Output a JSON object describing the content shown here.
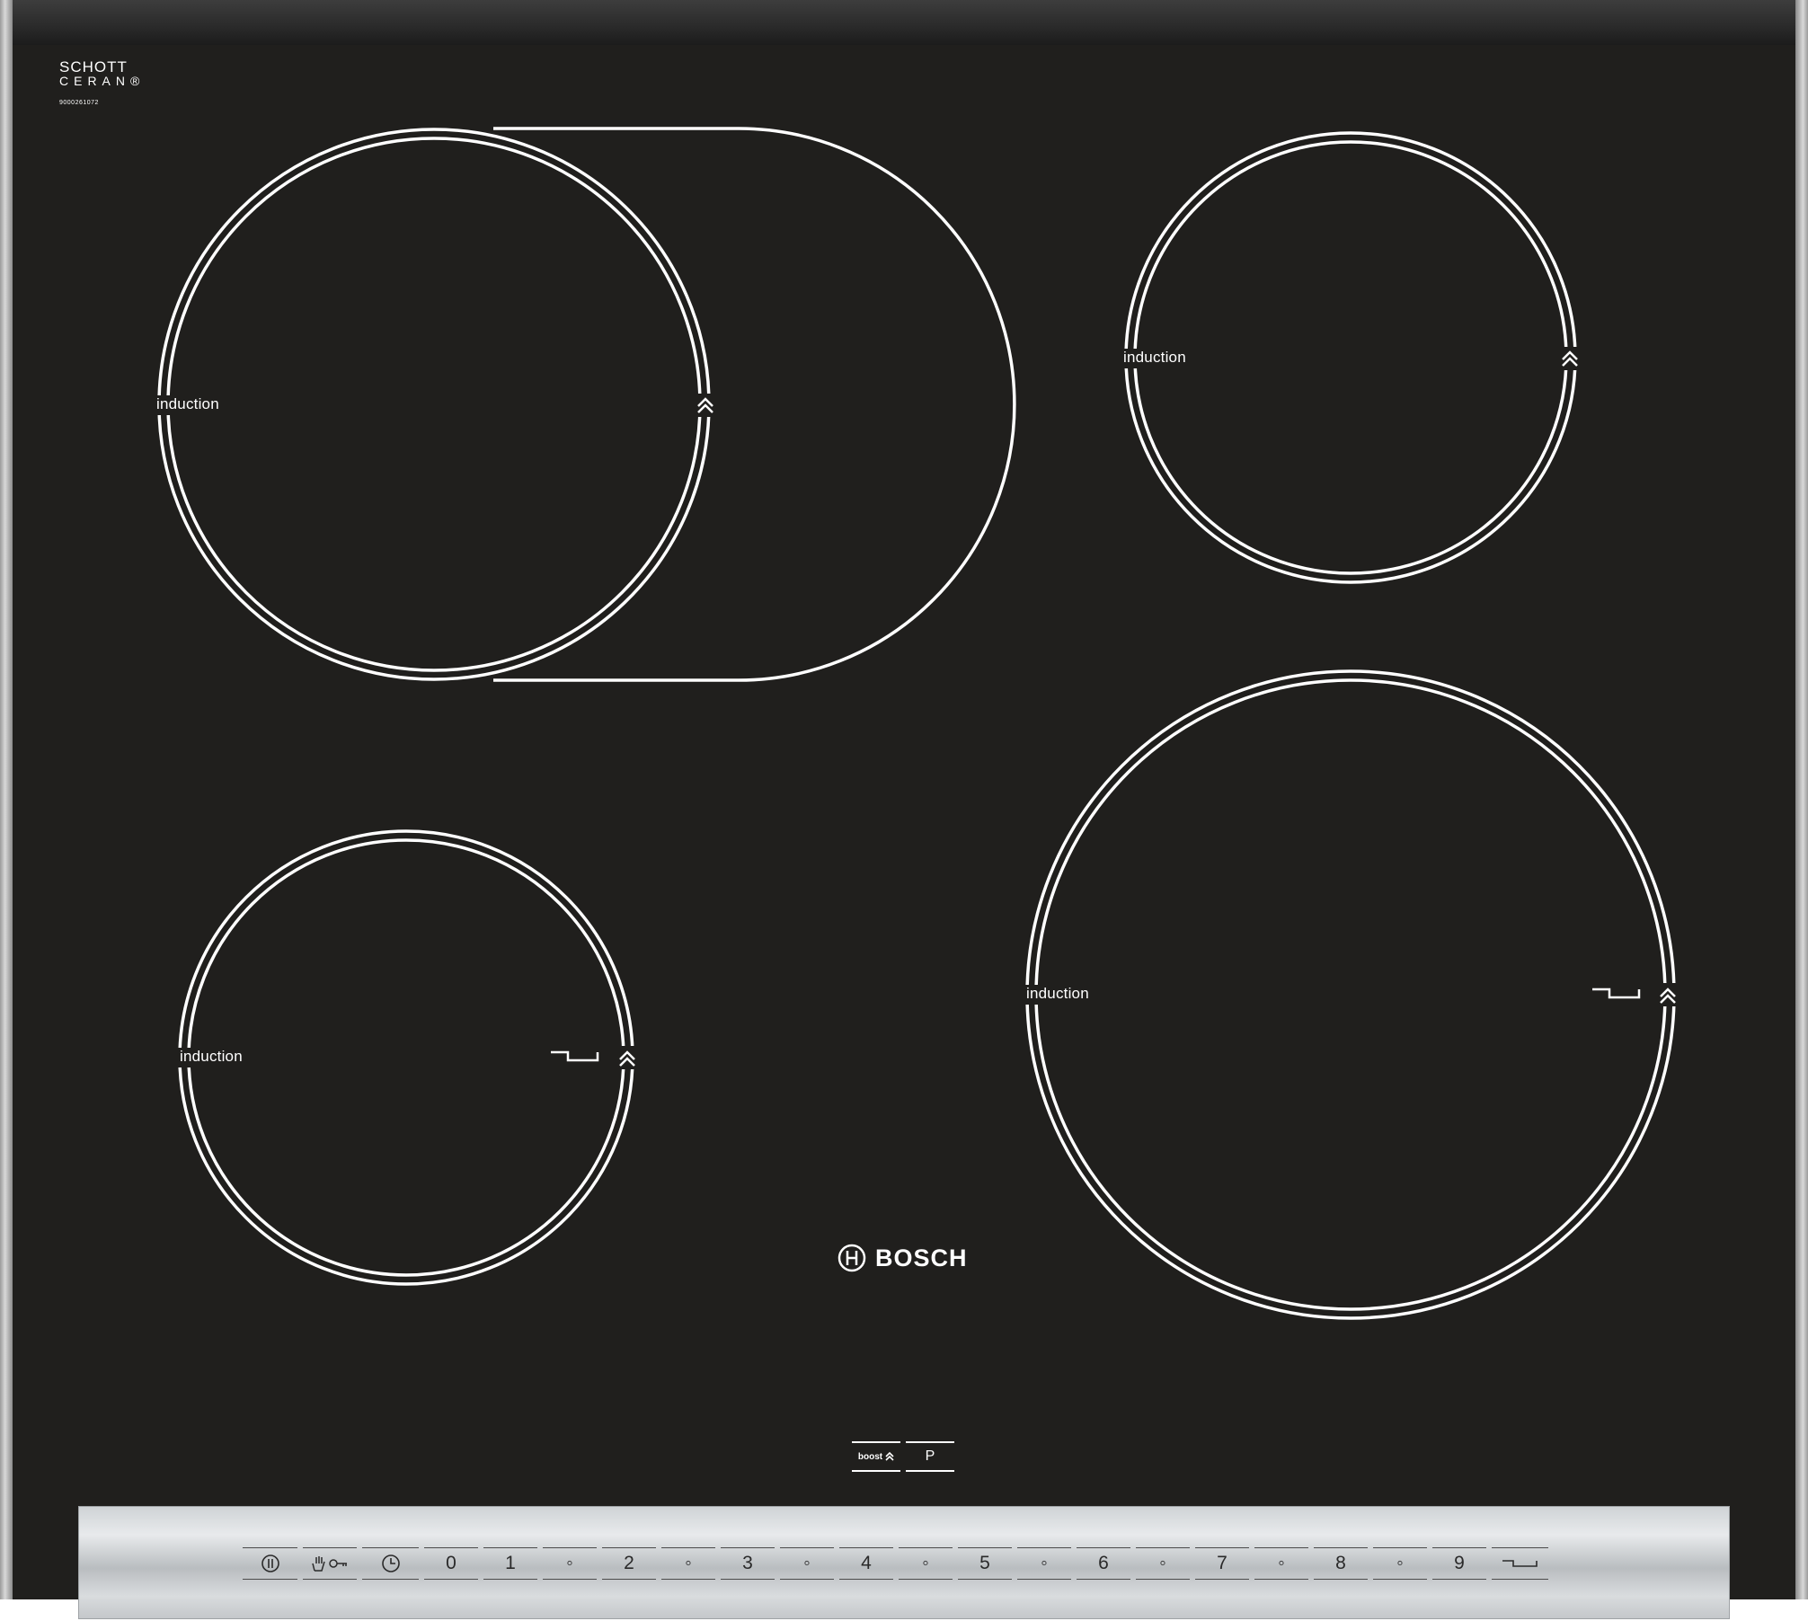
{
  "brand": {
    "glass_line1": "SCHOTT",
    "glass_line2": "CERAN®",
    "serial": "9000261072",
    "manufacturer": "BOSCH"
  },
  "zones": {
    "front_left_label": "induction",
    "rear_left_label": "induction",
    "rear_right_label": "induction",
    "front_right_label": "induction"
  },
  "aux": {
    "boost_label": "boost",
    "boost_icon": "chevron-up-double-icon",
    "p_label": "P"
  },
  "controls": {
    "keys": [
      {
        "name": "power-button",
        "text": "",
        "icon": "power-icon"
      },
      {
        "name": "child-lock-button",
        "text": "",
        "icon": "hand-key-icon"
      },
      {
        "name": "timer-button",
        "text": "",
        "icon": "clock-icon"
      },
      {
        "name": "level-0-button",
        "text": "0"
      },
      {
        "name": "level-1-button",
        "text": "1"
      },
      {
        "name": "level-1-5-button",
        "text": "◦"
      },
      {
        "name": "level-2-button",
        "text": "2"
      },
      {
        "name": "level-2-5-button",
        "text": "◦"
      },
      {
        "name": "level-3-button",
        "text": "3"
      },
      {
        "name": "level-3-5-button",
        "text": "◦"
      },
      {
        "name": "level-4-button",
        "text": "4"
      },
      {
        "name": "level-4-5-button",
        "text": "◦"
      },
      {
        "name": "level-5-button",
        "text": "5"
      },
      {
        "name": "level-5-5-button",
        "text": "◦"
      },
      {
        "name": "level-6-button",
        "text": "6"
      },
      {
        "name": "level-6-5-button",
        "text": "◦"
      },
      {
        "name": "level-7-button",
        "text": "7"
      },
      {
        "name": "level-7-5-button",
        "text": "◦"
      },
      {
        "name": "level-8-button",
        "text": "8"
      },
      {
        "name": "level-8-5-button",
        "text": "◦"
      },
      {
        "name": "level-9-button",
        "text": "9"
      },
      {
        "name": "frying-sensor-button",
        "text": "",
        "icon": "pan-icon"
      }
    ]
  }
}
